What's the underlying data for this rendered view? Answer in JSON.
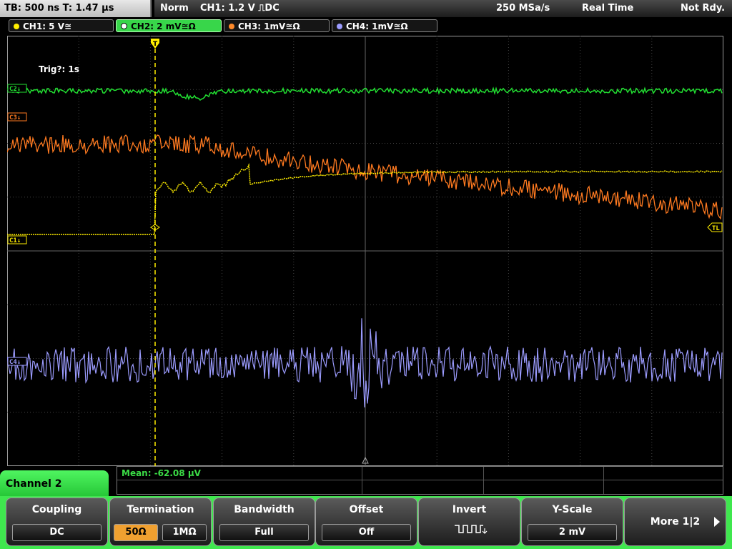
{
  "status": {
    "timebase": "TB: 500 ns  T: 1.47 µs",
    "mode": "Norm",
    "trigger": "CH1: 1.2 V ⎍DC",
    "sample_rate": "250 MSa/s",
    "acq_mode": "Real Time",
    "ready": "Not Rdy."
  },
  "channels": [
    {
      "label": "CH1: 5 V≅",
      "color": "#ffee00",
      "active": false
    },
    {
      "label": "CH2: 2 mV≅Ω",
      "color": "#38d64a",
      "active": true
    },
    {
      "label": "CH3: 1mV≅Ω",
      "color": "#ff8a2a",
      "active": false
    },
    {
      "label": "CH4: 1mV≅Ω",
      "color": "#9c9cff",
      "active": false
    }
  ],
  "markers": {
    "c1": "C1↓",
    "c2": "C2↓",
    "c3": "C3↓",
    "c4": "C4↓",
    "tl": "TL"
  },
  "trigger_info": "Trig?: 1s",
  "measurement": "Mean: -62.08 µV",
  "menu": {
    "title": "Channel 2",
    "coupling": {
      "label": "Coupling",
      "value": "DC"
    },
    "termination": {
      "label": "Termination",
      "opt1": "50Ω",
      "opt2": "1MΩ"
    },
    "bandwidth": {
      "label": "Bandwidth",
      "value": "Full"
    },
    "offset": {
      "label": "Offset",
      "value": "Off"
    },
    "invert": {
      "label": "Invert"
    },
    "yscale": {
      "label": "Y-Scale",
      "value": "2 mV"
    },
    "more": {
      "label": "More 1|2"
    }
  },
  "icons": {
    "trigger_marker": "trigger-position-icon",
    "invert": "invert-waveform-icon",
    "more_arrow": "arrow-right-icon"
  }
}
